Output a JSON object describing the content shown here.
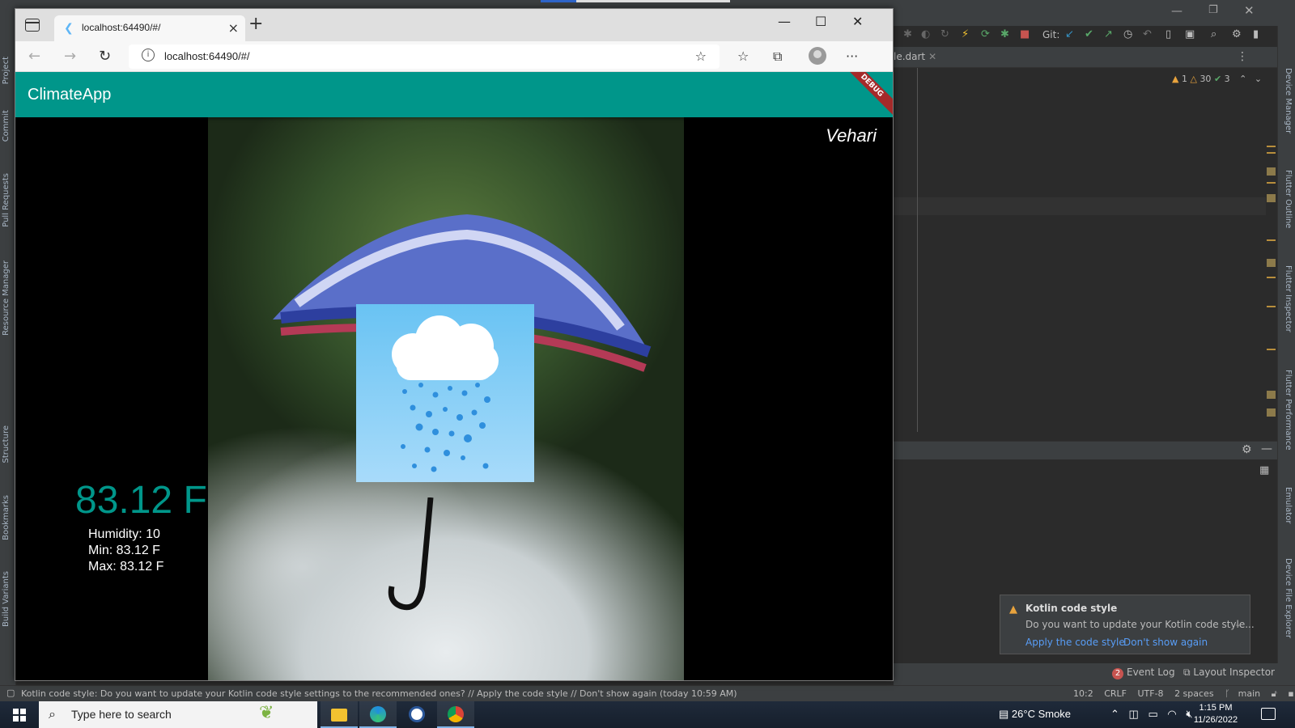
{
  "ide": {
    "file_tab": "le.dart",
    "warnings": {
      "errors": "1",
      "warnings": "30",
      "ok": "3"
    },
    "left_tabs": [
      "Project",
      "Commit",
      "Pull Requests",
      "Resource Manager",
      "Structure",
      "Bookmarks",
      "Build Variants"
    ],
    "right_tabs": [
      "Device Manager",
      "Flutter Outline",
      "Flutter Inspector",
      "Flutter Performance",
      "Emulator",
      "Device File Explorer"
    ],
    "git_label": "Git:",
    "event_log": {
      "count": "2",
      "label": "Event Log"
    },
    "layout_inspector": "Layout Inspector",
    "status_message": "Kotlin code style: Do you want to update your Kotlin code style settings to the recommended ones? // Apply the code style // Don't show again (today 10:59 AM)",
    "status_right": [
      "10:2",
      "CRLF",
      "UTF-8",
      "2 spaces",
      "main"
    ]
  },
  "notification": {
    "title": "Kotlin code style",
    "body": "Do you want to update your Kotlin code style...",
    "link_apply": "Apply the code style",
    "link_dismiss": "Don't show again"
  },
  "browser": {
    "tab_title": "localhost:64490/#/",
    "url": "localhost:64490/#/"
  },
  "app": {
    "title": "ClimateApp",
    "debug_banner": "DEBUG",
    "city": "Vehari",
    "temperature": "83.12 F",
    "humidity": "Humidity: 10",
    "min": "Min: 83.12 F",
    "max": "Max: 83.12 F"
  },
  "taskbar": {
    "search_placeholder": "Type here to search",
    "weather": "26°C  Smoke",
    "time": "1:15 PM",
    "date": "11/26/2022"
  }
}
